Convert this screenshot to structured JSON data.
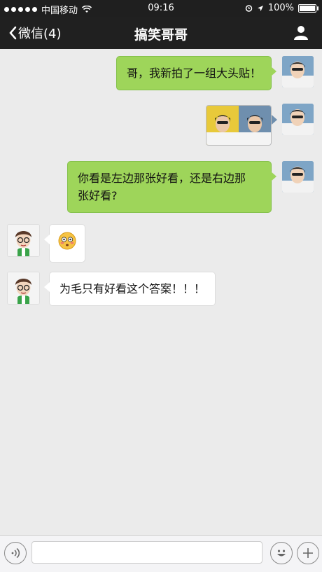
{
  "status_bar": {
    "carrier": "中国移动",
    "time": "09:16",
    "battery": "100%",
    "battery_level": 1.0,
    "signal_dots": 5
  },
  "nav": {
    "back_label": "微信(4)",
    "title": "搞笑哥哥",
    "profile_icon": "person-icon"
  },
  "messages": [
    {
      "sender": "me",
      "type": "text",
      "text": "哥，我新拍了一组大头贴！"
    },
    {
      "sender": "me",
      "type": "image",
      "description_icon": "photo-thumbnail"
    },
    {
      "sender": "me",
      "type": "text",
      "lines": [
        "你看是左边那张好看，还是右边那",
        "张好看?"
      ]
    },
    {
      "sender": "other",
      "type": "emoji",
      "emoji": "😳"
    },
    {
      "sender": "other",
      "type": "text",
      "text": "为毛只有好看这个答案！！！"
    }
  ],
  "input_bar": {
    "voice_icon": "voice-icon",
    "text_value": "",
    "emoji_icon": "smile-icon",
    "more_icon": "plus-icon"
  },
  "colors": {
    "my_bubble": "#9ed55a",
    "other_bubble": "#ffffff",
    "background": "#ebebeb",
    "nav": "#202020"
  }
}
